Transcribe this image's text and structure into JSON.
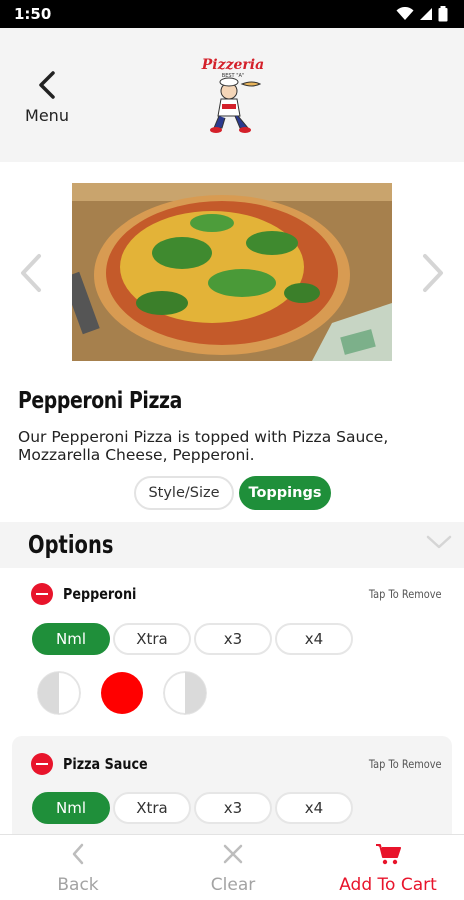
{
  "status": {
    "time": "1:50"
  },
  "header": {
    "back_label": "Menu",
    "logo_text": "Pizzeria",
    "logo_subtext": "BEST \"A\""
  },
  "item": {
    "title": "Pepperoni Pizza",
    "description": "Our Pepperoni Pizza is topped with Pizza Sauce, Mozzarella Cheese, Pepperoni."
  },
  "tabs": {
    "style_size": "Style/Size",
    "toppings": "Toppings"
  },
  "options": {
    "heading": "Options"
  },
  "toppings": [
    {
      "name": "Pepperoni",
      "remove_hint": "Tap To Remove",
      "amounts": [
        "Nml",
        "Xtra",
        "x3",
        "x4"
      ],
      "selected": "Nml"
    },
    {
      "name": "Pizza Sauce",
      "remove_hint": "Tap To Remove",
      "amounts": [
        "Nml",
        "Xtra",
        "x3",
        "x4"
      ],
      "selected": "Nml"
    }
  ],
  "bottom": {
    "back": "Back",
    "clear": "Clear",
    "add_to_cart": "Add To Cart"
  },
  "colors": {
    "accent_green": "#1f8f3a",
    "accent_red": "#e8142b"
  }
}
